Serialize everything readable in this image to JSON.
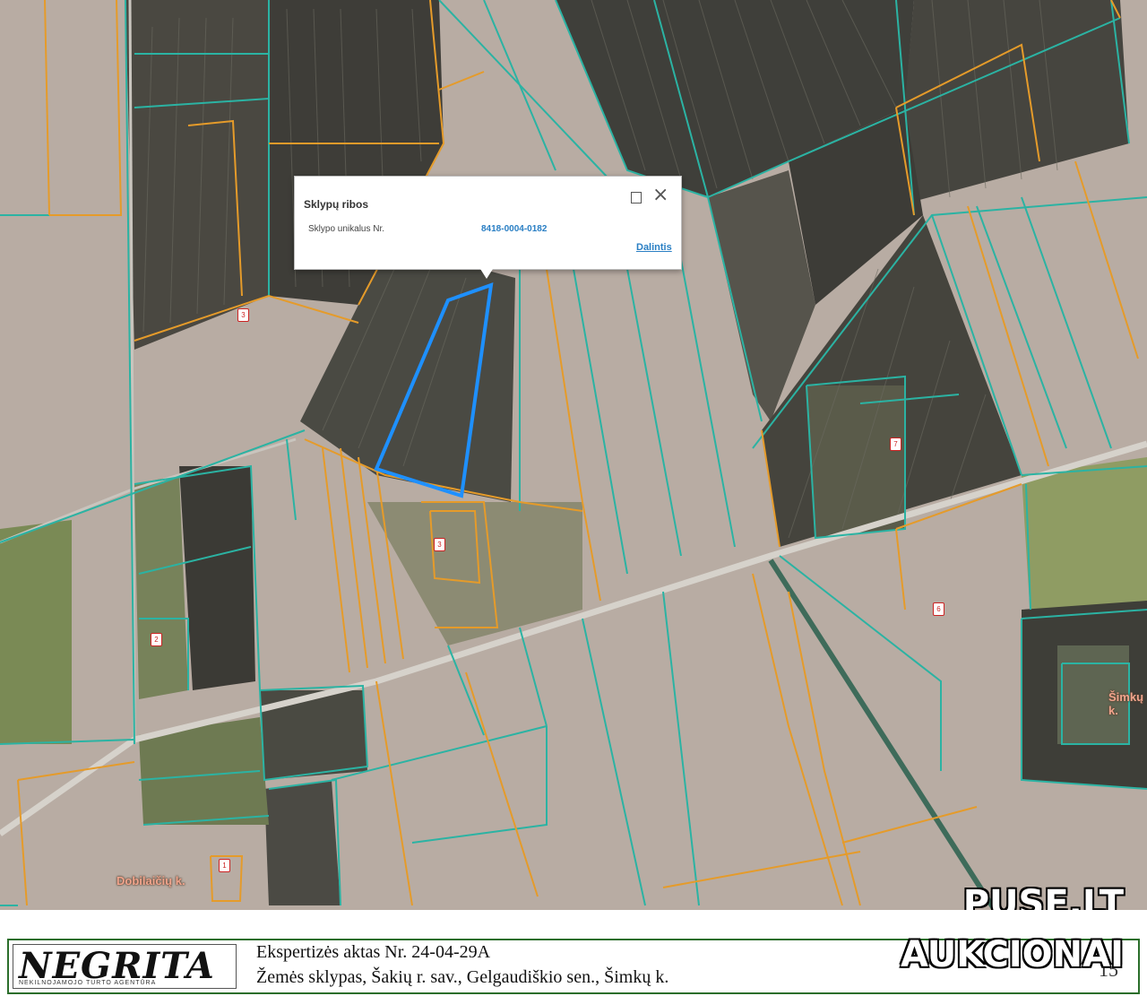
{
  "popup": {
    "title": "Sklypų ribos",
    "field_label": "Sklypo unikalus Nr.",
    "field_value": "8418-0004-0182",
    "share_link": "Dalintis"
  },
  "map_labels": {
    "village_simku": "Šimkų k.",
    "village_dobilaiciu": "Dobilaičių k."
  },
  "parcel_markers": [
    "3",
    "3",
    "7",
    "2",
    "6",
    "1"
  ],
  "colors": {
    "cadastral_boundary": "#2bb3a3",
    "parcel_boundary": "#e59b2a",
    "selected_parcel": "#1e90ff",
    "footer_border": "#2b6e2b"
  },
  "watermark": {
    "line1": "PUSE.LT",
    "line2": "AUKCIONAI"
  },
  "footer": {
    "logo_text": "NEGRITA",
    "logo_subtitle": "NEKILNOJAMOJO TURTO AGENTŪRA",
    "act_title": "Ekspertizės aktas Nr. 24-04-29A",
    "property_desc": "Žemės sklypas, Šakių r. sav., Gelgaudiškio sen., Šimkų k.",
    "page_number": "15"
  }
}
